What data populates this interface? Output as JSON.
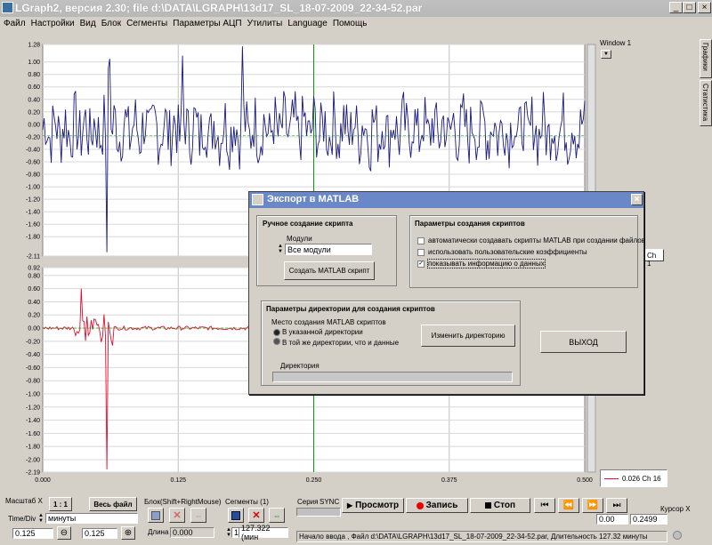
{
  "titlebar": {
    "title": "LGraph2, версия  2.30; file d:\\DATA\\LGRAPH\\13d17_SL_18-07-2009_22-34-52.par",
    "min": "_",
    "max": "□",
    "close": "×"
  },
  "menu": [
    "Файл",
    "Настройки",
    "Вид",
    "Блок",
    "Сегменты",
    "Параметры АЦП",
    "Утилиты",
    "Language",
    "Помощь"
  ],
  "right_panel": {
    "window_label": "Window 1",
    "tab_graphs": "Графики",
    "tab_stats": "Статистика",
    "ch1": "Ch 1",
    "legend_value": "0.026 Ch 16"
  },
  "chart_data": [
    {
      "type": "line",
      "y_ticks": [
        "1.28",
        "1.00",
        "0.80",
        "0.60",
        "0.40",
        "0.20",
        "0.00",
        "-0.20",
        "-0.40",
        "-0.60",
        "-0.80",
        "-1.00",
        "-1.20",
        "-1.40",
        "-1.60",
        "-1.80",
        "-2.11"
      ],
      "ylim": [
        -2.11,
        1.28
      ],
      "xlim": [
        0,
        0.5
      ],
      "series_color": "#1a1a80"
    },
    {
      "type": "line",
      "y_ticks": [
        "0.92",
        "0.80",
        "0.60",
        "0.40",
        "0.20",
        "0.00",
        "-0.20",
        "-0.40",
        "-0.60",
        "-0.80",
        "-1.00",
        "-1.20",
        "-1.40",
        "-1.60",
        "-1.80",
        "-2.00",
        "-2.19"
      ],
      "ylim": [
        -2.19,
        0.92
      ],
      "xlim": [
        0,
        0.5
      ],
      "x_ticks": [
        "0.000",
        "0.125",
        "0.250",
        "0.375",
        "0.500"
      ],
      "series_color": "#e01030"
    }
  ],
  "dialog": {
    "title": "Экспорт в MATLAB",
    "close": "×",
    "manual_group": "Ручное создание скрипта",
    "modules_label": "Модули",
    "modules_value": "Все модули",
    "create_button": "Создать MATLAB скрипт",
    "params_group": "Параметры создания скриптов",
    "opt1": "автоматически  создавать скрипты MATLAB при создании файлов",
    "opt2": "использовать пользовательские коэффициенты",
    "opt3": "показывать информацию о данных",
    "opt1_checked": false,
    "opt2_checked": false,
    "opt3_checked": true,
    "dir_group": "Параметры директории для создания скриптов",
    "place_label": "Место создания MATLAB скриптов",
    "radio1": "В указанной директории",
    "radio2": "В той же директории, что и данные",
    "change_dir_button": "Изменить директорию",
    "dir_label": "Директория",
    "dir_value": "",
    "exit_button": "ВЫХОД"
  },
  "bottom": {
    "scale_x_label": "Масштаб X",
    "ratio_button": "1 : 1",
    "full_file_button": "Весь файл",
    "timediv_label": "Time/Div",
    "minutes_value": "минуты",
    "val1": "0.125",
    "val2": "0.125",
    "block_label": "Блок(Shift+RightMouse)",
    "length_label": "Длина",
    "length_value": "0.000",
    "segments_label": "Сегменты (1)",
    "seg_index": "1",
    "seg_value": "127.322 (мин",
    "series_label": "Серия",
    "sync_label": "SYNC",
    "view_button": "Просмотр",
    "record_button": "Запись",
    "stop_button": "Стоп",
    "cursor_x_label": "Курсор X",
    "cursor_left": "0.00",
    "cursor_right": "0.2499",
    "status": "Начало ввода , Файл d:\\DATA\\LGRAPH\\13d17_SL_18-07-2009_22-34-52.par, Длительность 127.32 минуты"
  }
}
